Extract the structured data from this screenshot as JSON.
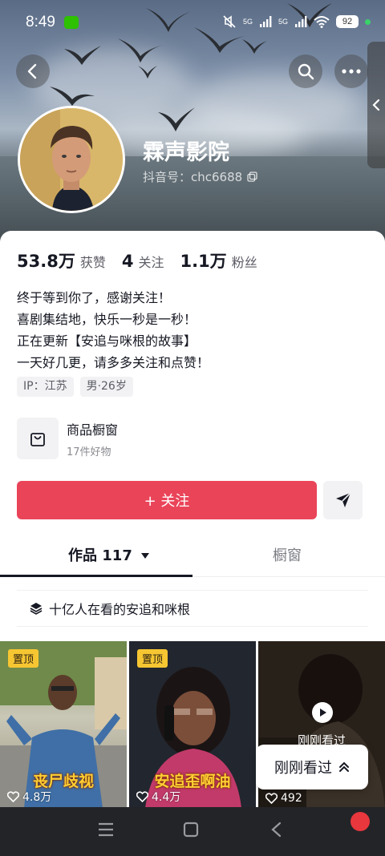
{
  "status_bar": {
    "time": "8:49",
    "signal_1": "5G",
    "signal_2": "5G",
    "battery": "92"
  },
  "profile": {
    "nickname": "霖声影院",
    "douyin_id": "抖音号：chc6688",
    "avatar_icon": "person-avatar"
  },
  "stats": [
    {
      "value": "53.8万",
      "label": "获赞"
    },
    {
      "value": "4",
      "label": "关注"
    },
    {
      "value": "1.1万",
      "label": "粉丝"
    }
  ],
  "bio": [
    "终于等到你了，感谢关注！",
    "喜剧集结地，快乐一秒是一秒！",
    "正在更新【安追与咪根的故事】",
    "一天好几更，请多多关注和点赞！"
  ],
  "tags": [
    "IP：江苏",
    "男·26岁"
  ],
  "shop": {
    "title": "商品橱窗",
    "subtitle": "17件好物"
  },
  "actions": {
    "follow_label": "+ 关注"
  },
  "tabs": {
    "works": "作品 117",
    "window": "橱窗"
  },
  "collection": {
    "label": "十亿人在看的安追和咪根"
  },
  "videos": [
    {
      "pinned": "置顶",
      "title": "丧尸歧视",
      "likes": "4.8万"
    },
    {
      "pinned": "置顶",
      "title": "安追歪啊油",
      "likes": "4.4万"
    },
    {
      "recent_label": "刚刚看过",
      "likes": "492"
    }
  ],
  "recent_pill": {
    "label": "刚刚看过"
  },
  "colors": {
    "accent": "#ea4459",
    "pin_badge": "#f6c632",
    "title_text": "#ffcf33"
  }
}
